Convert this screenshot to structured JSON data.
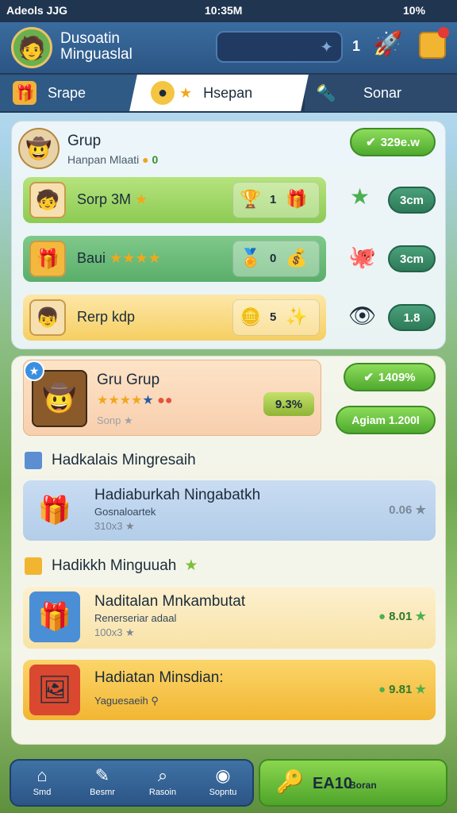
{
  "status_bar": {
    "left": "Adeols JJG",
    "time": "10:35M",
    "battery": "10%"
  },
  "header": {
    "name_line1": "Dusoatin",
    "name_line2": "Minguaslal",
    "count": "1"
  },
  "tabs": [
    {
      "label": "Srape"
    },
    {
      "label": "Hsepan"
    },
    {
      "label": "Sonar"
    }
  ],
  "group": {
    "title": "Grup",
    "subtitle": "Hanpan Mlaati",
    "subtitle_value": "0",
    "pill": "329e.w",
    "rows": [
      {
        "label": "Sorp 3M",
        "count": "1",
        "side_pill": "3cm"
      },
      {
        "label": "Baui",
        "count": "0",
        "side_pill": "3cm"
      },
      {
        "label": "Rerp kdp",
        "count": "5",
        "side_pill": "1.8"
      }
    ]
  },
  "featured": {
    "title": "Gru Grup",
    "subtitle": "Sonp",
    "pill": "9.3%",
    "badge_top": "1409%",
    "badge_bottom": "Agiam 1.200l"
  },
  "section1": {
    "heading": "Hadkalais Mingresaih",
    "items": [
      {
        "title": "Hadiaburkah Ningabatkh",
        "sub1": "Gosnaloartek",
        "sub2": "310x3",
        "value": "0.06"
      }
    ]
  },
  "section2": {
    "heading": "Hadikkh Minguuah",
    "items": [
      {
        "title": "Naditalan Mnkambutat",
        "sub1": "Renerseriar adaal",
        "sub2": "100x3",
        "value": "8.01"
      },
      {
        "title": "Hadiatan Minsdian:",
        "sub1": "Yaguesaeih",
        "sub2": "",
        "value": "9.81"
      }
    ]
  },
  "bottom_nav": [
    {
      "label": "Smd"
    },
    {
      "label": "Besmr"
    },
    {
      "label": "Rasoin"
    },
    {
      "label": "Sopntu"
    }
  ],
  "cta": {
    "label": "EA10",
    "sub": "Boran"
  }
}
